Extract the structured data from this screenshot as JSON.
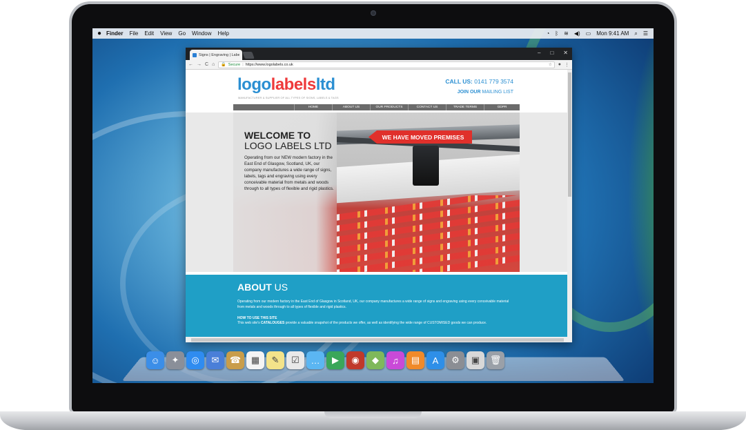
{
  "menubar": {
    "apple": "",
    "items": [
      "Finder",
      "File",
      "Edit",
      "View",
      "Go",
      "Window",
      "Help"
    ],
    "clock": "Mon 9:41 AM"
  },
  "browser": {
    "tab_title": "Signs | Engraving | Label ✕",
    "secure_label": "Secure",
    "url": "https://www.logolabels.co.uk"
  },
  "site": {
    "logo": {
      "part1": "logo",
      "part2": "labels",
      "part3": "ltd"
    },
    "tagline": "MANUFACTURER & SUPPLIER OF ALL TYPES OF SIGNS, LABELS & TAGS",
    "call_label": "CALL US:",
    "call_number": "0141 779 3574",
    "join_bold": "JOIN OUR",
    "join_rest": "MAILING LIST",
    "nav": [
      "HOME",
      "ABOUT US",
      "OUR PRODUCTS",
      "CONTACT US",
      "TRADE TERMS",
      "GDPR"
    ],
    "hero": {
      "banner": "WE HAVE MOVED PREMISES",
      "title_line1": "WELCOME TO",
      "title_line2": "LOGO LABELS LTD",
      "text": "Operating from our NEW modern factory in the East End of Glasgow, Scotland, UK, our company manufactures a wide range of signs, labels, tags and engraving using every conceivable material from metals and woods through to all types of flexible and rigid plastics."
    },
    "about": {
      "title_bold": "ABOUT",
      "title_rest": "US",
      "text": "Operating from our modern factory in the East End of Glasgow in Scotland, UK, our company manufactures a wide range of signs and engraving using every conceivable material from metals and woods through to all types of flexible and rigid plastics.",
      "how_title": "HOW TO USE THIS SITE",
      "how_prefix": "This web site's",
      "how_bold": "CATALOUGES",
      "how_rest": "provide a valuable snapshot of the products we offer, as well as identifying the wide range of CUSTOMISED goods we can produce."
    }
  },
  "dock": {
    "icons": [
      "finder-icon",
      "launchpad-icon",
      "safari-icon",
      "mail-icon",
      "contacts-icon",
      "calendar-icon",
      "notes-icon",
      "reminders-icon",
      "messages-icon",
      "facetime-icon",
      "photo-booth-icon",
      "maps-icon",
      "itunes-icon",
      "ibooks-icon",
      "app-store-icon",
      "system-preferences-icon",
      "preview-icon",
      "trash-icon"
    ],
    "colors": [
      "#3b8ee8",
      "#8a8f99",
      "#2f8cf0",
      "#4a7fd8",
      "#c99d4a",
      "#f4f4f4",
      "#f3e38a",
      "#e9e9e9",
      "#5bb6f2",
      "#3aa65a",
      "#c0392b",
      "#7fb85b",
      "#c94ad8",
      "#f08a2a",
      "#2e8fe8",
      "#8b8e94",
      "#d8d8d8",
      "#9aa0a8"
    ]
  },
  "colors": {
    "brand_blue": "#2b8fd2",
    "brand_red": "#ee3a3b",
    "about_bg": "#1f9fc6",
    "banner_red": "#e0302b"
  }
}
